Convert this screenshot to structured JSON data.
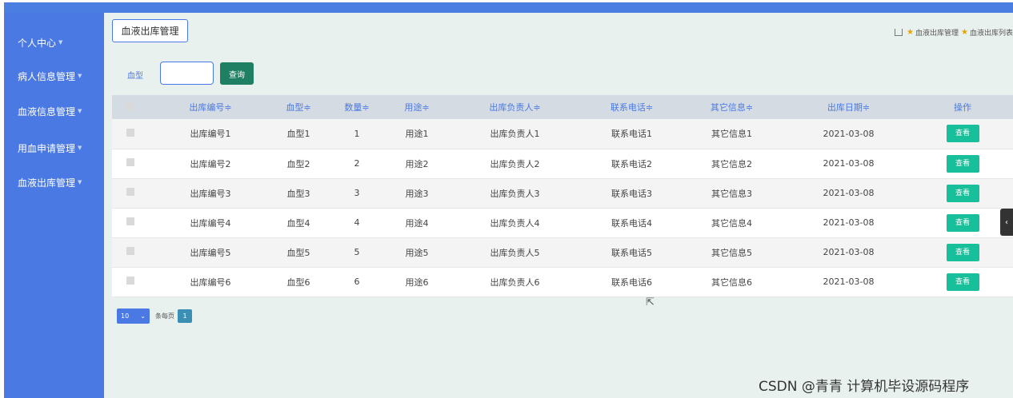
{
  "sidebar": {
    "items": [
      {
        "label": "个人中心"
      },
      {
        "label": "病人信息管理"
      },
      {
        "label": "血液信息管理"
      },
      {
        "label": "用血申请管理"
      },
      {
        "label": "血液出库管理"
      }
    ]
  },
  "header": {
    "title": "血液出库管理",
    "breadcrumb": [
      "血液出库管理",
      "血液出库列表"
    ]
  },
  "search": {
    "label": "血型",
    "placeholder": "",
    "button": "查询"
  },
  "table": {
    "columns": [
      "出库编号≑",
      "血型≑",
      "数量≑",
      "用途≑",
      "出库负责人≑",
      "联系电话≑",
      "其它信息≑",
      "出库日期≑",
      "操作"
    ],
    "rows": [
      [
        "出库编号1",
        "血型1",
        "1",
        "用途1",
        "出库负责人1",
        "联系电话1",
        "其它信息1",
        "2021-03-08",
        "查看"
      ],
      [
        "出库编号2",
        "血型2",
        "2",
        "用途2",
        "出库负责人2",
        "联系电话2",
        "其它信息2",
        "2021-03-08",
        "查看"
      ],
      [
        "出库编号3",
        "血型3",
        "3",
        "用途3",
        "出库负责人3",
        "联系电话3",
        "其它信息3",
        "2021-03-08",
        "查看"
      ],
      [
        "出库编号4",
        "血型4",
        "4",
        "用途4",
        "出库负责人4",
        "联系电话4",
        "其它信息4",
        "2021-03-08",
        "查看"
      ],
      [
        "出库编号5",
        "血型5",
        "5",
        "用途5",
        "出库负责人5",
        "联系电话5",
        "其它信息5",
        "2021-03-08",
        "查看"
      ],
      [
        "出库编号6",
        "血型6",
        "6",
        "用途6",
        "出库负责人6",
        "联系电话6",
        "其它信息6",
        "2021-03-08",
        "查看"
      ]
    ]
  },
  "pager": {
    "page_size": "10",
    "per_page_label": "条每页",
    "current_page": "1"
  },
  "watermark": "CSDN @青青  计算机毕设源码程序",
  "colors": {
    "sidebar": "#4a79e3",
    "search_button": "#1e7f62",
    "view_button": "#17c09a",
    "main_bg": "#e9f1ee"
  }
}
